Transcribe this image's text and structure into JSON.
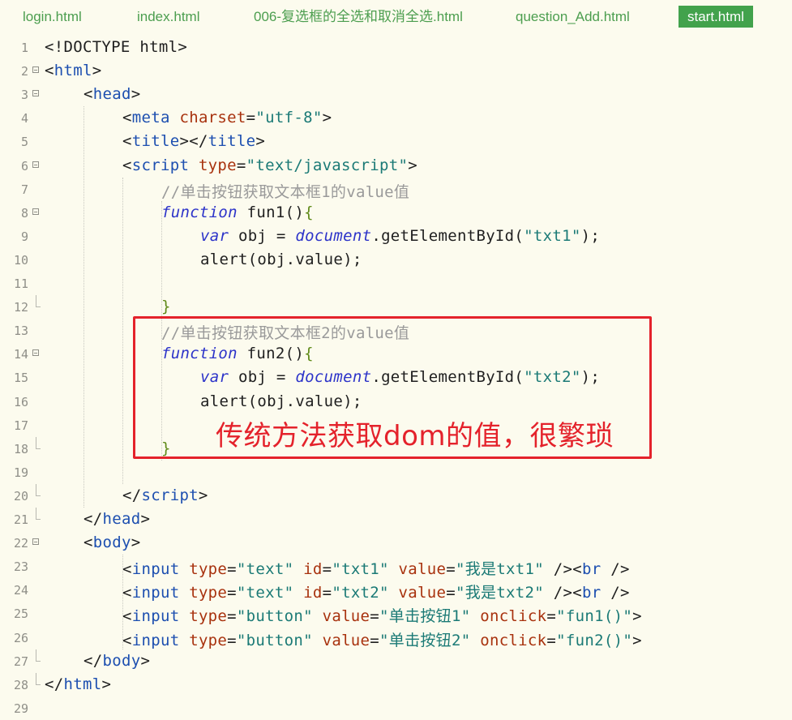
{
  "tabs": [
    {
      "label": "login.html",
      "active": false
    },
    {
      "label": "index.html",
      "active": false
    },
    {
      "label": "006-复选框的全选和取消全选.html",
      "active": false
    },
    {
      "label": "question_Add.html",
      "active": false
    },
    {
      "label": "start.html",
      "active": true
    }
  ],
  "colors": {
    "background": "#fcfbee",
    "active_tab": "#42a24c",
    "tag": "#1d4fb0",
    "attribute": "#a8320e",
    "string": "#1b7a76",
    "keyword": "#2c33c9",
    "comment": "#9a9a9a",
    "annotation": "#e4222b"
  },
  "lines": [
    {
      "n": "1",
      "fold": "",
      "indent": 0,
      "tokens": [
        [
          "p",
          "<!DOCTYPE html>"
        ]
      ]
    },
    {
      "n": "2",
      "fold": "open",
      "indent": 0,
      "tokens": [
        [
          "p",
          "<"
        ],
        [
          "t",
          "html"
        ],
        [
          "p",
          ">"
        ]
      ]
    },
    {
      "n": "3",
      "fold": "open",
      "indent": 1,
      "tokens": [
        [
          "p",
          "<"
        ],
        [
          "t",
          "head"
        ],
        [
          "p",
          ">"
        ]
      ]
    },
    {
      "n": "4",
      "fold": "",
      "indent": 2,
      "tokens": [
        [
          "p",
          "<"
        ],
        [
          "t",
          "meta"
        ],
        [
          "p",
          " "
        ],
        [
          "a",
          "charset"
        ],
        [
          "p",
          "="
        ],
        [
          "s",
          "\"utf-8\""
        ],
        [
          "p",
          ">"
        ]
      ]
    },
    {
      "n": "5",
      "fold": "",
      "indent": 2,
      "tokens": [
        [
          "p",
          "<"
        ],
        [
          "t",
          "title"
        ],
        [
          "p",
          "></"
        ],
        [
          "t",
          "title"
        ],
        [
          "p",
          ">"
        ]
      ]
    },
    {
      "n": "6",
      "fold": "open",
      "indent": 2,
      "tokens": [
        [
          "p",
          "<"
        ],
        [
          "t",
          "script"
        ],
        [
          "p",
          " "
        ],
        [
          "a",
          "type"
        ],
        [
          "p",
          "="
        ],
        [
          "s",
          "\"text/javascript\""
        ],
        [
          "p",
          ">"
        ]
      ]
    },
    {
      "n": "7",
      "fold": "",
      "indent": 3,
      "tokens": [
        [
          "c",
          "//单击按钮获取文本框1的value值"
        ]
      ]
    },
    {
      "n": "8",
      "fold": "open",
      "indent": 3,
      "tokens": [
        [
          "k",
          "function"
        ],
        [
          "p",
          " fun1()"
        ],
        [
          "br",
          "{"
        ]
      ]
    },
    {
      "n": "9",
      "fold": "",
      "indent": 4,
      "tokens": [
        [
          "k",
          "var"
        ],
        [
          "p",
          " obj = "
        ],
        [
          "k",
          "document"
        ],
        [
          "p",
          ".getElementById("
        ],
        [
          "s",
          "\"txt1\""
        ],
        [
          "p",
          ");"
        ]
      ]
    },
    {
      "n": "10",
      "fold": "",
      "indent": 4,
      "tokens": [
        [
          "p",
          "alert(obj.value);"
        ]
      ]
    },
    {
      "n": "11",
      "fold": "",
      "indent": 0,
      "tokens": []
    },
    {
      "n": "12",
      "fold": "end",
      "indent": 3,
      "tokens": [
        [
          "br",
          "}"
        ]
      ]
    },
    {
      "n": "13",
      "fold": "",
      "indent": 3,
      "tokens": [
        [
          "c",
          "//单击按钮获取文本框2的value值"
        ]
      ]
    },
    {
      "n": "14",
      "fold": "open",
      "indent": 3,
      "tokens": [
        [
          "k",
          "function"
        ],
        [
          "p",
          " fun2()"
        ],
        [
          "br",
          "{"
        ]
      ]
    },
    {
      "n": "15",
      "fold": "",
      "indent": 4,
      "tokens": [
        [
          "k",
          "var"
        ],
        [
          "p",
          " obj = "
        ],
        [
          "k",
          "document"
        ],
        [
          "p",
          ".getElementById("
        ],
        [
          "s",
          "\"txt2\""
        ],
        [
          "p",
          ");"
        ]
      ]
    },
    {
      "n": "16",
      "fold": "",
      "indent": 4,
      "tokens": [
        [
          "p",
          "alert(obj.value);"
        ]
      ]
    },
    {
      "n": "17",
      "fold": "",
      "indent": 0,
      "tokens": []
    },
    {
      "n": "18",
      "fold": "end",
      "indent": 3,
      "tokens": [
        [
          "br",
          "}"
        ]
      ]
    },
    {
      "n": "19",
      "fold": "",
      "indent": 0,
      "tokens": []
    },
    {
      "n": "20",
      "fold": "end",
      "indent": 2,
      "tokens": [
        [
          "p",
          "</"
        ],
        [
          "t",
          "script"
        ],
        [
          "p",
          ">"
        ]
      ]
    },
    {
      "n": "21",
      "fold": "end",
      "indent": 1,
      "tokens": [
        [
          "p",
          "</"
        ],
        [
          "t",
          "head"
        ],
        [
          "p",
          ">"
        ]
      ]
    },
    {
      "n": "22",
      "fold": "open",
      "indent": 1,
      "tokens": [
        [
          "p",
          "<"
        ],
        [
          "t",
          "body"
        ],
        [
          "p",
          ">"
        ]
      ]
    },
    {
      "n": "23",
      "fold": "",
      "indent": 2,
      "tokens": [
        [
          "p",
          "<"
        ],
        [
          "t",
          "input"
        ],
        [
          "p",
          " "
        ],
        [
          "a",
          "type"
        ],
        [
          "p",
          "="
        ],
        [
          "s",
          "\"text\""
        ],
        [
          "p",
          " "
        ],
        [
          "a",
          "id"
        ],
        [
          "p",
          "="
        ],
        [
          "s",
          "\"txt1\""
        ],
        [
          "p",
          " "
        ],
        [
          "a",
          "value"
        ],
        [
          "p",
          "="
        ],
        [
          "s",
          "\"我是txt1\""
        ],
        [
          "p",
          " /><"
        ],
        [
          "t",
          "br"
        ],
        [
          "p",
          " />"
        ]
      ]
    },
    {
      "n": "24",
      "fold": "",
      "indent": 2,
      "tokens": [
        [
          "p",
          "<"
        ],
        [
          "t",
          "input"
        ],
        [
          "p",
          " "
        ],
        [
          "a",
          "type"
        ],
        [
          "p",
          "="
        ],
        [
          "s",
          "\"text\""
        ],
        [
          "p",
          " "
        ],
        [
          "a",
          "id"
        ],
        [
          "p",
          "="
        ],
        [
          "s",
          "\"txt2\""
        ],
        [
          "p",
          " "
        ],
        [
          "a",
          "value"
        ],
        [
          "p",
          "="
        ],
        [
          "s",
          "\"我是txt2\""
        ],
        [
          "p",
          " /><"
        ],
        [
          "t",
          "br"
        ],
        [
          "p",
          " />"
        ]
      ]
    },
    {
      "n": "25",
      "fold": "",
      "indent": 2,
      "tokens": [
        [
          "p",
          "<"
        ],
        [
          "t",
          "input"
        ],
        [
          "p",
          " "
        ],
        [
          "a",
          "type"
        ],
        [
          "p",
          "="
        ],
        [
          "s",
          "\"button\""
        ],
        [
          "p",
          " "
        ],
        [
          "a",
          "value"
        ],
        [
          "p",
          "="
        ],
        [
          "s",
          "\"单击按钮1\""
        ],
        [
          "p",
          " "
        ],
        [
          "a",
          "onclick"
        ],
        [
          "p",
          "="
        ],
        [
          "s",
          "\"fun1()\""
        ],
        [
          "p",
          ">"
        ]
      ]
    },
    {
      "n": "26",
      "fold": "",
      "indent": 2,
      "tokens": [
        [
          "p",
          "<"
        ],
        [
          "t",
          "input"
        ],
        [
          "p",
          " "
        ],
        [
          "a",
          "type"
        ],
        [
          "p",
          "="
        ],
        [
          "s",
          "\"button\""
        ],
        [
          "p",
          " "
        ],
        [
          "a",
          "value"
        ],
        [
          "p",
          "="
        ],
        [
          "s",
          "\"单击按钮2\""
        ],
        [
          "p",
          " "
        ],
        [
          "a",
          "onclick"
        ],
        [
          "p",
          "="
        ],
        [
          "s",
          "\"fun2()\""
        ],
        [
          "p",
          ">"
        ]
      ]
    },
    {
      "n": "27",
      "fold": "end",
      "indent": 1,
      "tokens": [
        [
          "p",
          "</"
        ],
        [
          "t",
          "body"
        ],
        [
          "p",
          ">"
        ]
      ]
    },
    {
      "n": "28",
      "fold": "end",
      "indent": 0,
      "tokens": [
        [
          "p",
          "</"
        ],
        [
          "t",
          "html"
        ],
        [
          "p",
          ">"
        ]
      ]
    },
    {
      "n": "29",
      "fold": "",
      "indent": 0,
      "tokens": []
    }
  ],
  "annotation": {
    "text": "传统方法获取dom的值，很繁琐"
  }
}
